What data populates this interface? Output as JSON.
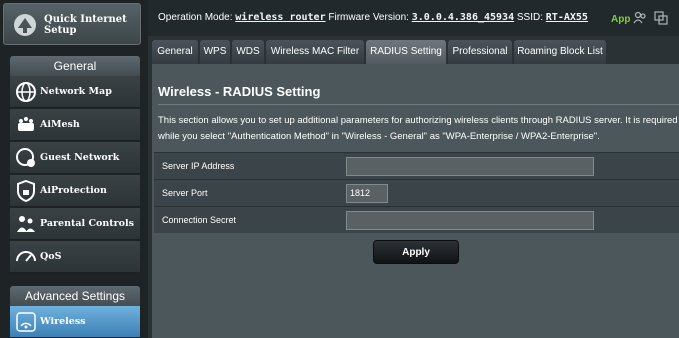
{
  "sidebar": {
    "quick_setup": "Quick Internet Setup",
    "general_header": "General",
    "general_items": [
      {
        "label": "Network Map",
        "icon": "globe-network-icon"
      },
      {
        "label": "AiMesh",
        "icon": "mesh-router-icon"
      },
      {
        "label": "Guest Network",
        "icon": "guest-network-icon"
      },
      {
        "label": "AiProtection",
        "icon": "shield-lock-icon"
      },
      {
        "label": "Parental Controls",
        "icon": "family-icon"
      },
      {
        "label": "QoS",
        "icon": "speedometer-icon"
      }
    ],
    "advanced_header": "Advanced Settings",
    "advanced_items": [
      {
        "label": "Wireless",
        "icon": "wifi-icon",
        "active": true
      }
    ]
  },
  "status": {
    "mode_label": "Operation Mode:",
    "mode_value": "wireless router",
    "fw_label": "Firmware Version:",
    "fw_value": "3.0.0.4.386_45934",
    "ssid_label": "SSID:",
    "ssid_value": "RT-AX55",
    "app_label": "App",
    "app_color": "#7cd32e"
  },
  "tabs": [
    "General",
    "WPS",
    "WDS",
    "Wireless MAC Filter",
    "RADIUS Setting",
    "Professional",
    "Roaming Block List"
  ],
  "active_tab": "RADIUS Setting",
  "main": {
    "title": "Wireless - RADIUS Setting",
    "description": "This section allows you to set up additional parameters for authorizing wireless clients through RADIUS server. It is required while you select \"Authentication Method\" in \"Wireless - General\" as \"WPA-Enterprise / WPA2-Enterprise\".",
    "fields": [
      {
        "label": "Server IP Address",
        "value": ""
      },
      {
        "label": "Server Port",
        "value": "1812"
      },
      {
        "label": "Connection Secret",
        "value": ""
      }
    ],
    "apply_label": "Apply"
  }
}
